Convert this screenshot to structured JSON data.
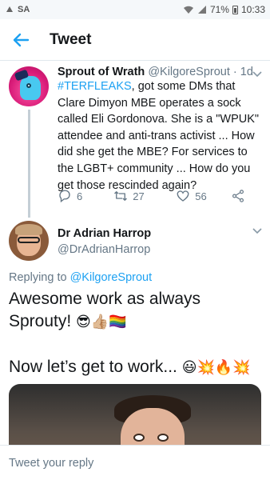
{
  "status_bar": {
    "carrier": "SA",
    "battery": "71%",
    "time": "10:33"
  },
  "header": {
    "title": "Tweet"
  },
  "tweet1": {
    "name": "Sprout of Wrath",
    "handle": "@KilgoreSprout",
    "time": "· 1d",
    "hashtag": "#TERFLEAKS",
    "text": ", got some DMs that Clare Dimyon MBE operates a sock called Eli Gordonova. She is a \"WPUK\" attendee and anti-trans activist ... How did she get the MBE? For services to the LGBT+ community ... How do you get those rescinded again?",
    "replies": "6",
    "retweets": "27",
    "likes": "56"
  },
  "tweet2": {
    "name": "Dr Adrian Harrop",
    "handle": "@DrAdrianHarrop",
    "replying_label": "Replying to ",
    "replying_to": "@KilgoreSprout",
    "line1": "Awesome work as always Sprouty! ",
    "line1_emoji": "😎👍🏼🏳️‍🌈",
    "line2": "Now let’s get to work... ",
    "line2_emoji": "😃💥🔥💥"
  },
  "reply_bar": {
    "placeholder": "Tweet your reply"
  }
}
